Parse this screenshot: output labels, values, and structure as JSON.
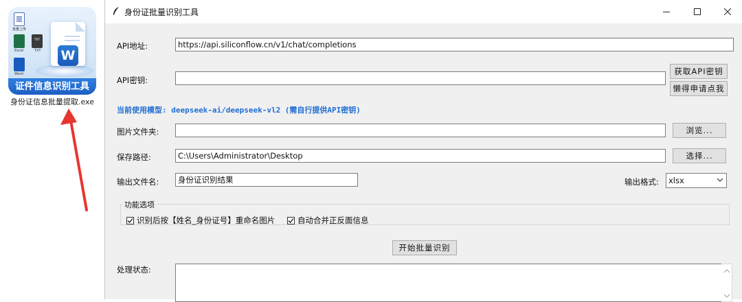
{
  "desktop": {
    "icon_banner": "证件信息识别工具",
    "icon_caption": "身份证信息批量提取.exe",
    "mini_icons": [
      {
        "label": "批量上传",
        "color": "#4a6fb5"
      },
      {
        "label": "Excel",
        "color": "#1e7145"
      },
      {
        "label": "TXT",
        "color": "#3a3a3a"
      },
      {
        "label": "Word",
        "color": "#185abd"
      }
    ],
    "word_letter": "W"
  },
  "window": {
    "title": "身份证批量识别工具",
    "controls": {
      "minimize": "minimize-icon",
      "maximize": "maximize-icon",
      "close": "close-icon"
    }
  },
  "form": {
    "api_url_label": "API地址:",
    "api_url_value": "https://api.siliconflow.cn/v1/chat/completions",
    "api_key_label": "API密钥:",
    "api_key_value": "",
    "get_key_button": "获取API密钥",
    "lazy_apply_button": "懒得申请点我",
    "model_line": "当前使用模型: deepseek-ai/deepseek-vl2 (需自行提供API密钥)",
    "image_folder_label": "图片文件夹:",
    "image_folder_value": "",
    "browse_button": "浏览...",
    "save_path_label": "保存路径:",
    "save_path_value": "C:\\Users\\Administrator\\Desktop",
    "choose_button": "选择...",
    "output_name_label": "输出文件名:",
    "output_name_value": "身份证识别结果",
    "output_format_label": "输出格式:",
    "output_format_value": "xlsx"
  },
  "options": {
    "title": "功能选项",
    "rename_label": "识别后按【姓名_身份证号】重命名图片",
    "rename_checked": true,
    "merge_label": "自动合并正反面信息",
    "merge_checked": true
  },
  "actions": {
    "start_button": "开始批量识别"
  },
  "status": {
    "label": "处理状态:",
    "value": ""
  },
  "colors": {
    "accent_blue": "#1f6ed4",
    "arrow_red": "#e8352f",
    "window_bg": "#f0f0f0"
  }
}
